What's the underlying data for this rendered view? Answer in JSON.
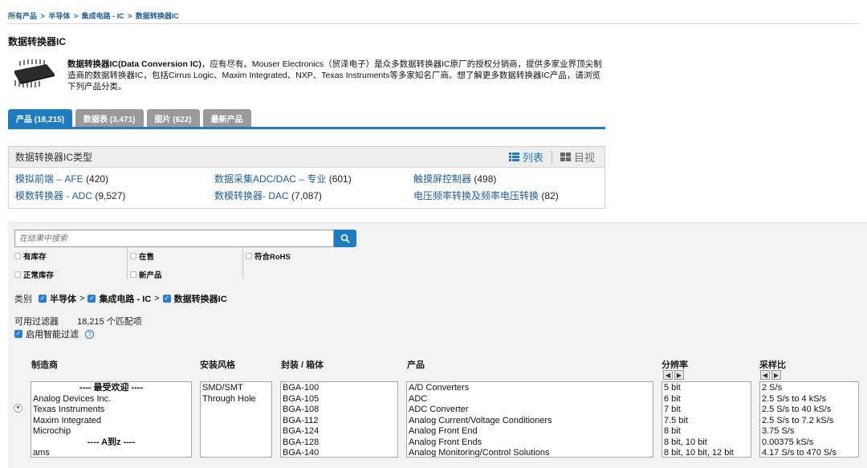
{
  "breadcrumb": [
    "所有产品",
    "半导体",
    "集成电路 - IC",
    "数据转换器IC"
  ],
  "breadcrumb_sep": ">",
  "page_title": "数据转换器IC",
  "intro": {
    "bold": "数据转换器IC(Data Conversion IC)",
    "rest": "，应有尽有。Mouser Electronics（贸泽电子）是众多数据转换器IC原厂的授权分销商，提供多家业界顶尖制造商的数据转换器IC，包括Cirrus Logic、Maxim Integrated、NXP、Texas Instruments等多家知名厂商。想了解更多数据转换器IC产品，请浏览下列产品分类。"
  },
  "tabs": [
    {
      "label": "产品 (18,215)",
      "active": true
    },
    {
      "label": "数据表 (3,471)",
      "active": false
    },
    {
      "label": "图片 (622)",
      "active": false
    },
    {
      "label": "最新产品",
      "active": false
    }
  ],
  "types": {
    "title": "数据转换器IC类型",
    "view_list": "列表",
    "view_grid": "目视",
    "items": [
      {
        "label": "模拟前端 – AFE",
        "count": "(420)"
      },
      {
        "label": "数据采集ADC/DAC – 专业",
        "count": "(601)"
      },
      {
        "label": "触摸屏控制器",
        "count": "(498)"
      },
      {
        "label": "模数转换器 - ADC",
        "count": "(9,527)"
      },
      {
        "label": "数模转换器- DAC",
        "count": "(7,087)"
      },
      {
        "label": "电压频率转换及频率电压转换",
        "count": "(82)"
      }
    ]
  },
  "search": {
    "placeholder": "在结果中搜索"
  },
  "checkboxes": [
    "有库存",
    "在售",
    "符合RoHS",
    "正常库存",
    "新产品"
  ],
  "category": {
    "label": "类别",
    "path": [
      "半导体",
      "集成电路 - IC",
      "数据转换器IC"
    ]
  },
  "available": {
    "label": "可用过滤器",
    "count": "18,215 个匹配项"
  },
  "smart_filter": "启用智能过滤",
  "columns": {
    "manufacturer": {
      "title": "制造商",
      "options": [
        "---- 最受欢迎 ----",
        "Analog Devices Inc.",
        "Texas Instruments",
        "Maxim Integrated",
        "Microchip",
        "---- A到z ----",
        "ams"
      ]
    },
    "mount": {
      "title": "安装风格",
      "options": [
        "SMD/SMT",
        "Through Hole"
      ]
    },
    "package": {
      "title": "封装 / 箱体",
      "options": [
        "BGA-100",
        "BGA-105",
        "BGA-108",
        "BGA-112",
        "BGA-124",
        "BGA-128",
        "BGA-140"
      ]
    },
    "product": {
      "title": "产品",
      "options": [
        "A/D Converters",
        "ADC",
        "ADC Converter",
        "Analog Current/Voltage Conditioners",
        "Analog Front End",
        "Analog Front Ends",
        "Analog Monitoring/Control Solutions"
      ]
    },
    "resolution": {
      "title": "分辨率",
      "options": [
        "5 bit",
        "6 bit",
        "7 bit",
        "7.5 bit",
        "8 bit",
        "8 bit, 10 bit",
        "8 bit, 10 bit, 12 bit"
      ]
    },
    "sample_rate": {
      "title": "采样比",
      "options": [
        "2 S/s",
        "2.5 S/s to 4 kS/s",
        "2.5 S/s to 40 kS/s",
        "2.5 S/s to 7.2 kS/s",
        "3.75 S/s",
        "0.00375 kS/s",
        "4.17 S/s to 470 S/s"
      ]
    }
  }
}
